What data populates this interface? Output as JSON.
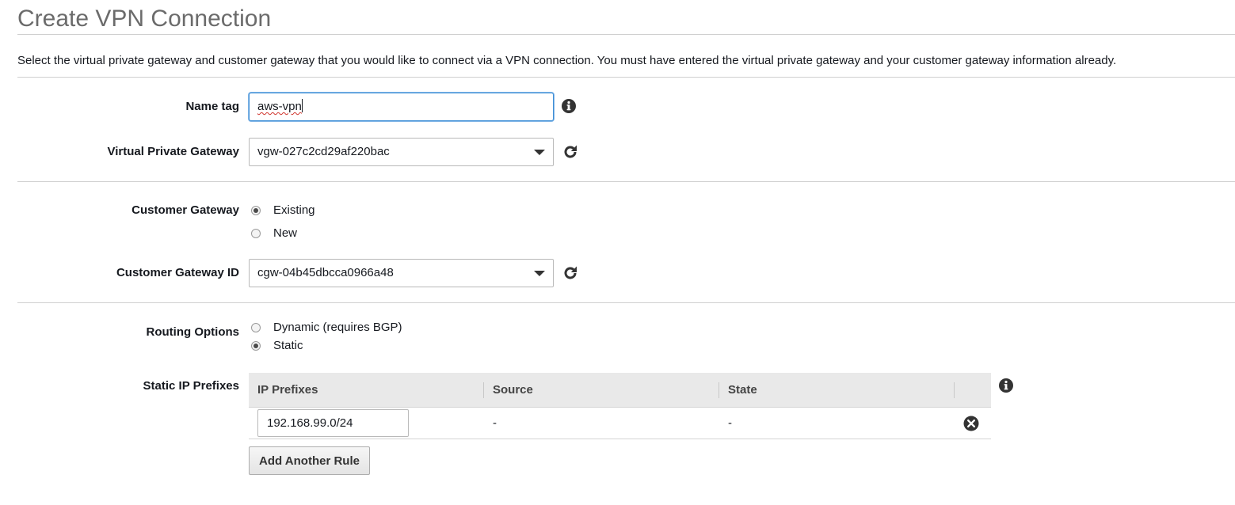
{
  "page": {
    "title": "Create VPN Connection",
    "description": "Select the virtual private gateway and customer gateway that you would like to connect via a VPN connection. You must have entered the virtual private gateway and your customer gateway information already."
  },
  "name_tag": {
    "label": "Name tag",
    "value": "aws-vpn",
    "info_icon": "info-icon"
  },
  "virtual_private_gateway": {
    "label": "Virtual Private Gateway",
    "selected": "vgw-027c2cd29af220bac",
    "refresh_icon": "refresh-icon"
  },
  "customer_gateway": {
    "label": "Customer Gateway",
    "options": [
      {
        "label": "Existing",
        "checked": true
      },
      {
        "label": "New",
        "checked": false
      }
    ]
  },
  "customer_gateway_id": {
    "label": "Customer Gateway ID",
    "selected": "cgw-04b45dbcca0966a48",
    "refresh_icon": "refresh-icon"
  },
  "routing_options": {
    "label": "Routing Options",
    "options": [
      {
        "label": "Dynamic (requires BGP)",
        "checked": false
      },
      {
        "label": "Static",
        "checked": true
      }
    ]
  },
  "static_ip_prefixes": {
    "label": "Static IP Prefixes",
    "columns": [
      "IP Prefixes",
      "Source",
      "State"
    ],
    "rows": [
      {
        "ip_prefix": "192.168.99.0/24",
        "source": "-",
        "state": "-"
      }
    ],
    "add_button": "Add Another Rule",
    "info_icon": "info-icon",
    "remove_icon": "remove-circle-icon"
  },
  "colors": {
    "title": "#6b6b6b",
    "focus_border": "#3f8fd6",
    "table_header_bg": "#e9e9e9",
    "icon": "#333333"
  }
}
